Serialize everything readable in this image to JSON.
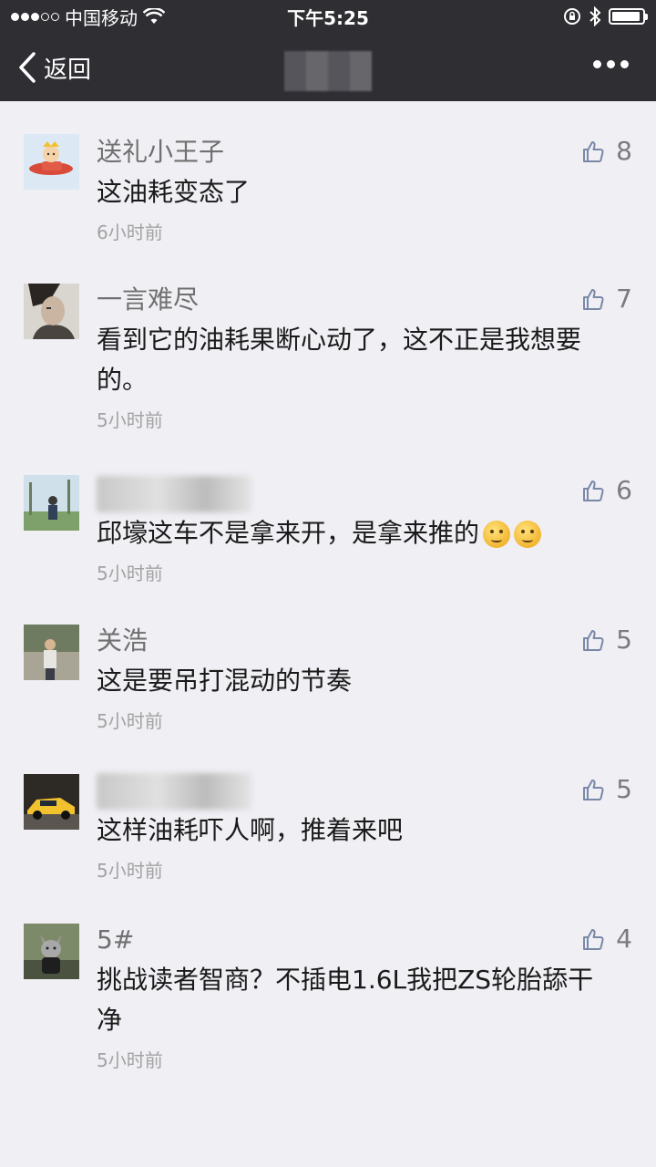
{
  "status_bar": {
    "carrier": "中国移动",
    "time": "下午5:25"
  },
  "nav": {
    "back_label": "返回"
  },
  "comments": [
    {
      "username": "送礼小王子",
      "text": "这油耗变态了",
      "time": "6小时前",
      "likes": "8",
      "avatar": "red-plane-avatar"
    },
    {
      "username": "一言难尽",
      "text": "看到它的油耗果断心动了，这不正是我想要的。",
      "time": "5小时前",
      "likes": "7",
      "avatar": "portrait-avatar"
    },
    {
      "username": "",
      "text": "邱壕这车不是拿来开，是拿来推的",
      "time": "5小时前",
      "likes": "6",
      "avatar": "outdoor-avatar"
    },
    {
      "username": "关浩",
      "text": "这是要吊打混动的节奏",
      "time": "5小时前",
      "likes": "5",
      "avatar": "person-avatar"
    },
    {
      "username": "",
      "text": "这样油耗吓人啊，推着来吧",
      "time": "5小时前",
      "likes": "5",
      "avatar": "yellow-car-avatar"
    },
    {
      "username": "5#",
      "text": "挑战读者智商？不插电1.6L我把ZS轮胎舔干净",
      "time": "5小时前",
      "likes": "4",
      "avatar": "cat-avatar"
    }
  ]
}
